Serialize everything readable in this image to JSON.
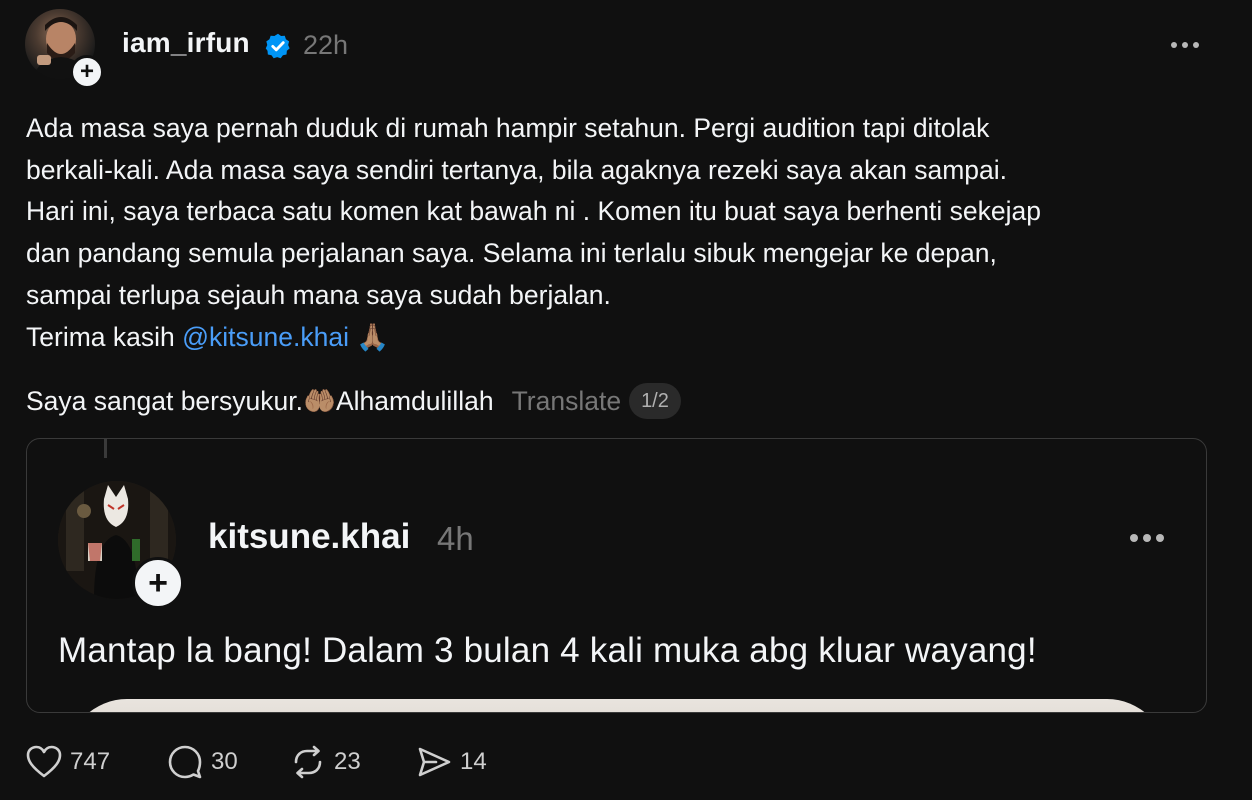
{
  "header": {
    "username": "iam_irfun",
    "time": "22h"
  },
  "post": {
    "lines": [
      "Ada masa saya pernah duduk di rumah hampir setahun. Pergi audition tapi ditolak",
      "berkali-kali. Ada masa saya sendiri tertanya, bila agaknya rezeki saya akan sampai.",
      "Hari ini, saya terbaca satu komen kat bawah ni . Komen itu buat saya berhenti sekejap",
      "dan pandang semula perjalanan saya. Selama ini terlalu sibuk mengejar ke depan,",
      "sampai terlupa sejauh mana saya sudah berjalan."
    ],
    "thanks_prefix": "Terima kasih ",
    "mention": "@kitsune.khai",
    "pray_emoji": "🙏🏽",
    "grateful_text": "Saya sangat bersyukur.",
    "hands_emoji": "🤲🏽",
    "alhamdulillah": " Alhamdulillah",
    "translate_label": "Translate",
    "page_indicator": "1/2"
  },
  "quote": {
    "username": "kitsune.khai",
    "time": "4h",
    "text": "Mantap la bang! Dalam 3 bulan 4 kali muka abg kluar wayang!"
  },
  "actions": {
    "likes": "747",
    "replies": "30",
    "reposts": "23",
    "shares": "14"
  },
  "colors": {
    "background": "#101010",
    "text": "#f3f5f7",
    "muted": "#777777",
    "mention": "#4a9df8",
    "verified": "#0095f6"
  }
}
